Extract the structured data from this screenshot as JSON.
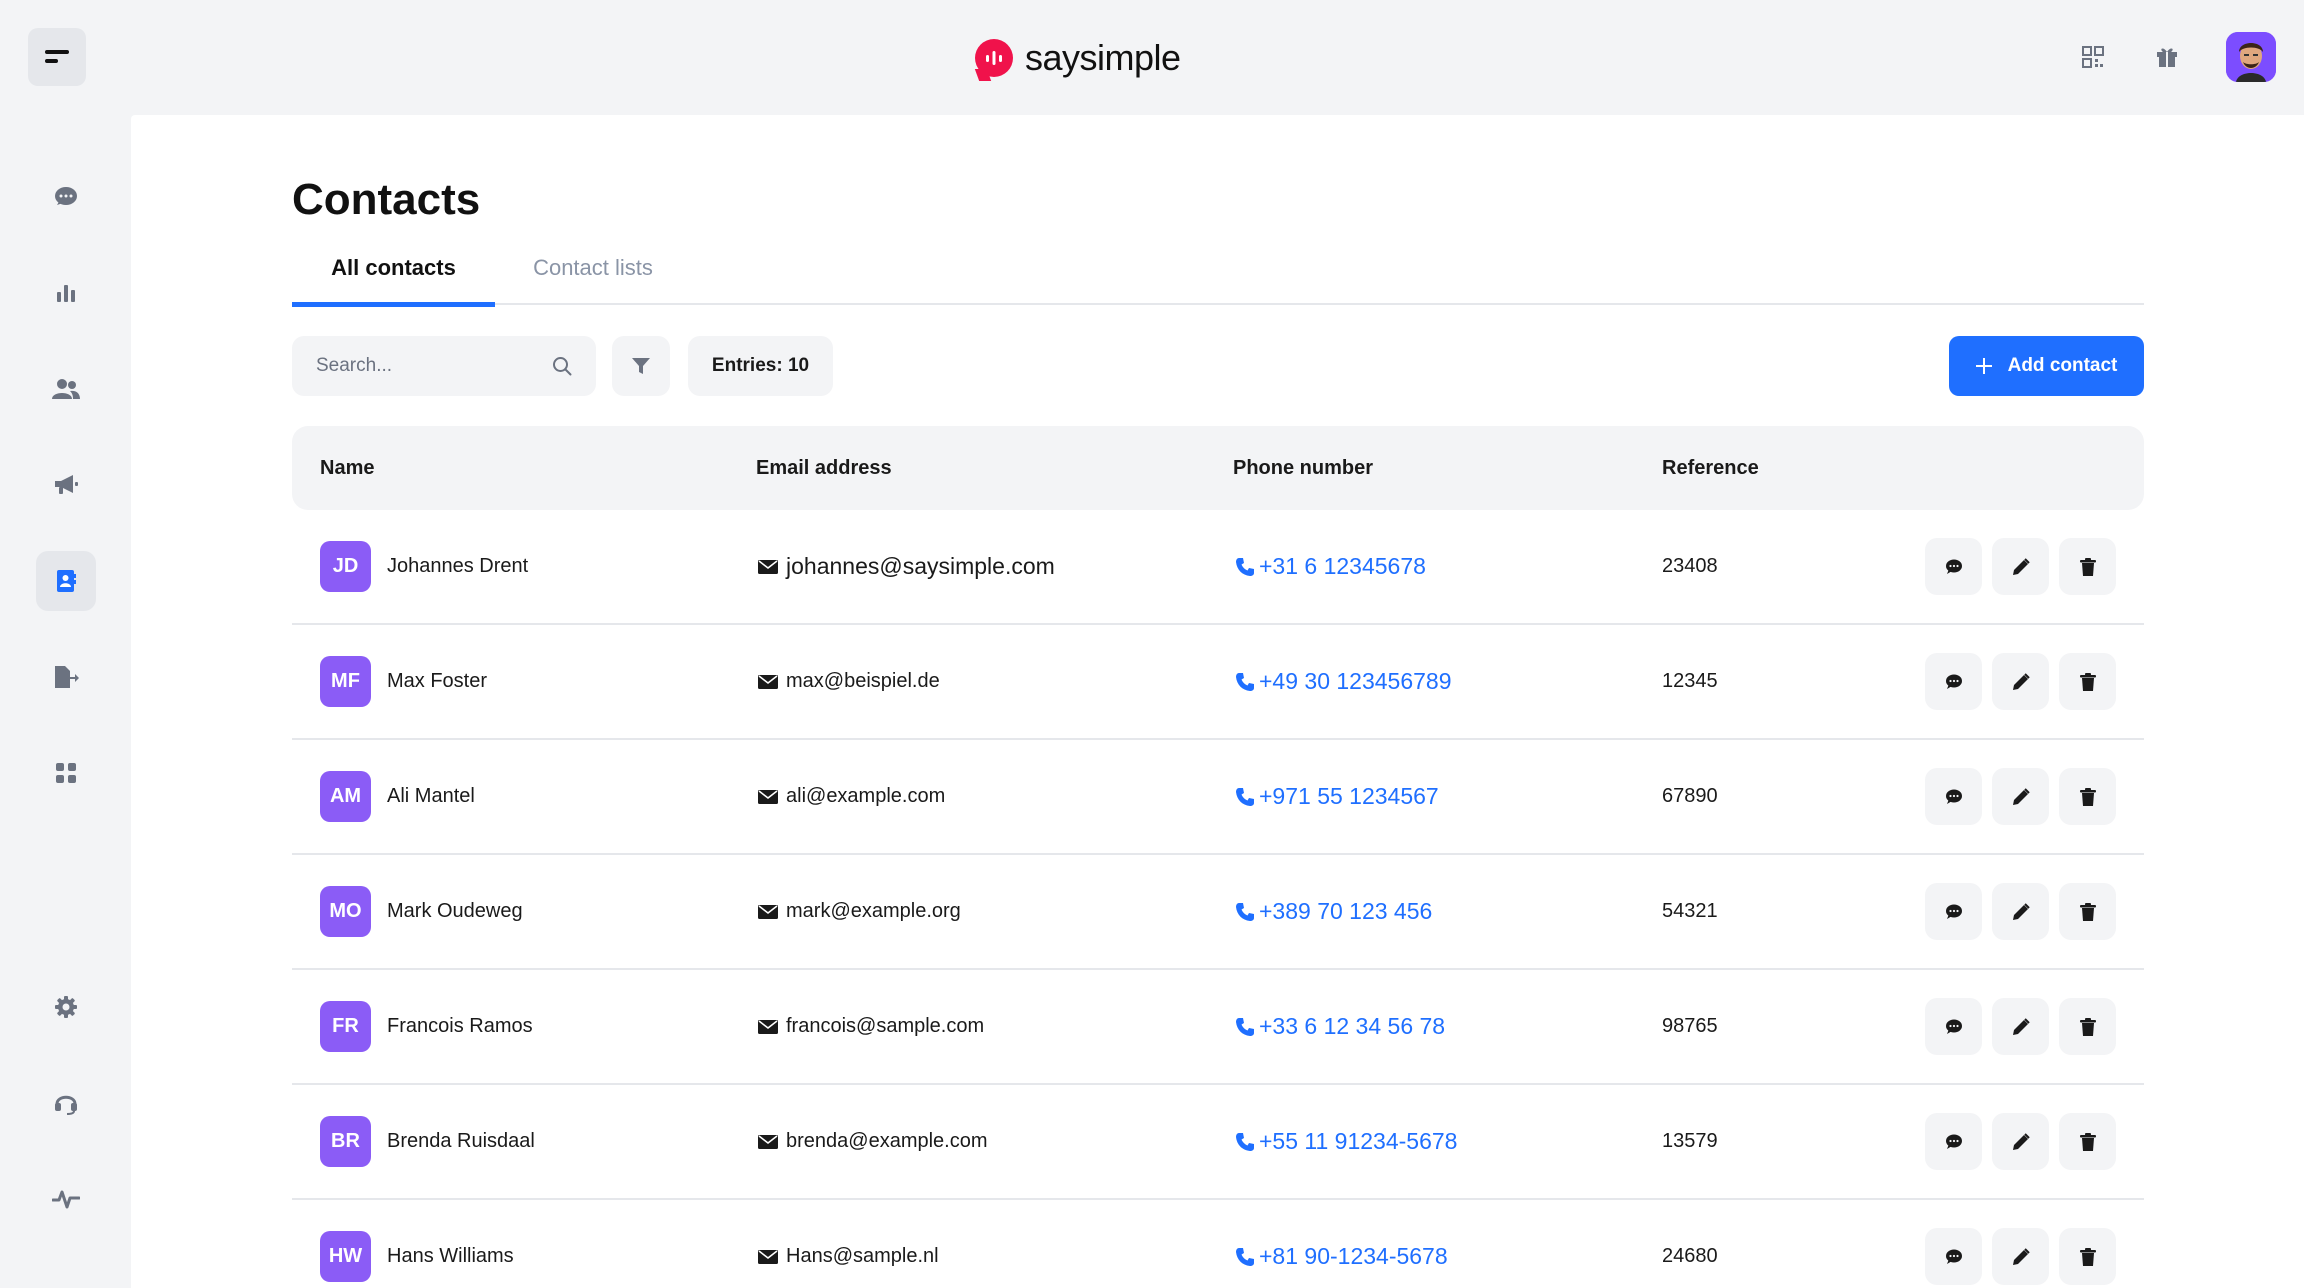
{
  "app": {
    "logo_text": "saysimple"
  },
  "sidebar": {
    "items": [
      {
        "icon": "chat-icon"
      },
      {
        "icon": "bar-chart-icon"
      },
      {
        "icon": "users-icon"
      },
      {
        "icon": "megaphone-icon"
      },
      {
        "icon": "contacts-book-icon",
        "active": true
      },
      {
        "icon": "file-export-icon"
      },
      {
        "icon": "apps-grid-icon"
      },
      {
        "icon": "gear-icon"
      },
      {
        "icon": "headset-icon"
      },
      {
        "icon": "activity-pulse-icon"
      }
    ]
  },
  "header": {
    "page_title": "Contacts",
    "tabs": [
      {
        "label": "All contacts",
        "active": true
      },
      {
        "label": "Contact lists",
        "active": false
      }
    ]
  },
  "toolbar": {
    "search_placeholder": "Search...",
    "entries_label": "Entries: 10",
    "add_label": "Add contact"
  },
  "table": {
    "columns": [
      "Name",
      "Email address",
      "Phone number",
      "Reference"
    ],
    "rows": [
      {
        "initials": "JD",
        "name": "Johannes Drent",
        "email": "johannes@saysimple.com",
        "phone": "+31 6 12345678",
        "reference": "23408"
      },
      {
        "initials": "MF",
        "name": "Max Foster",
        "email": "max@beispiel.de",
        "phone": "+49 30 123456789",
        "reference": "12345"
      },
      {
        "initials": "AM",
        "name": "Ali Mantel",
        "email": "ali@example.com",
        "phone": "+971 55 1234567",
        "reference": "67890"
      },
      {
        "initials": "MO",
        "name": "Mark Oudeweg",
        "email": "mark@example.org",
        "phone": "+389 70 123 456",
        "reference": "54321"
      },
      {
        "initials": "FR",
        "name": "Francois Ramos",
        "email": "francois@sample.com",
        "phone": "+33 6 12 34 56 78",
        "reference": "98765"
      },
      {
        "initials": "BR",
        "name": "Brenda Ruisdaal",
        "email": "brenda@example.com",
        "phone": "+55 11 91234-5678",
        "reference": "13579"
      },
      {
        "initials": "HW",
        "name": "Hans Williams",
        "email": "Hans@sample.nl",
        "phone": "+81 90-1234-5678",
        "reference": "24680"
      }
    ]
  },
  "colors": {
    "accent": "#1f6fff",
    "avatar_bg": "#8b5cf6",
    "brand": "#f0124b"
  }
}
